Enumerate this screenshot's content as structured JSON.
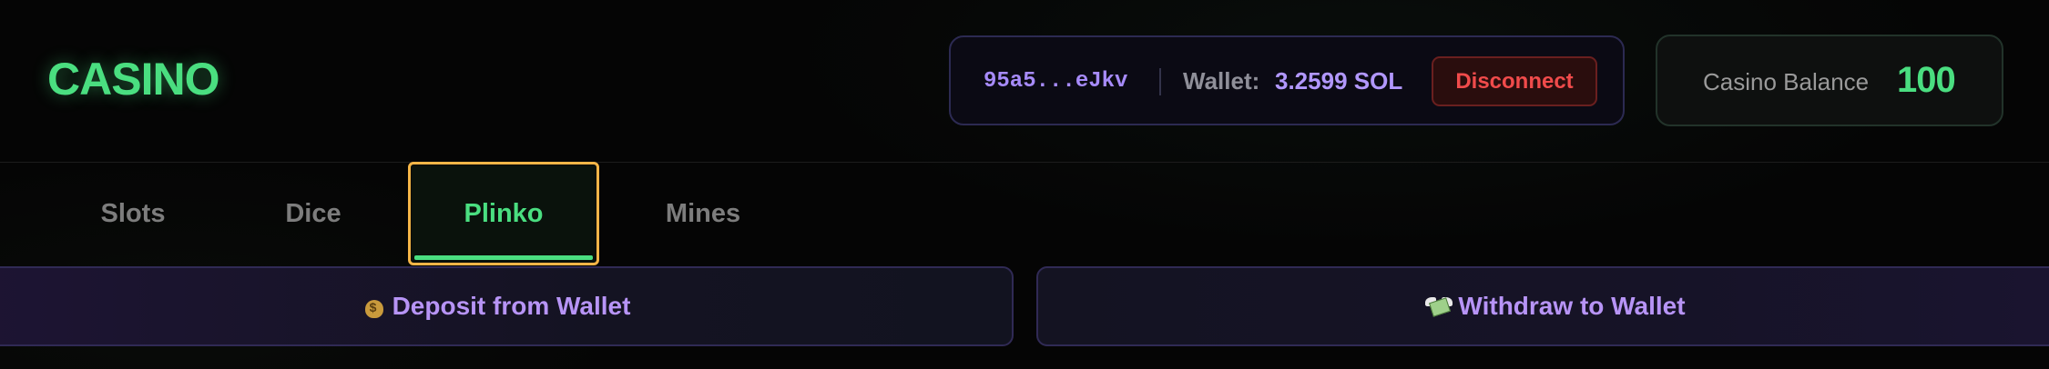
{
  "header": {
    "logo": "CASINO"
  },
  "wallet": {
    "address": "95a5...eJkv",
    "label": "Wallet:",
    "sol_balance": "3.2599 SOL",
    "disconnect_label": "Disconnect"
  },
  "casino_balance": {
    "label": "Casino Balance",
    "value": "100"
  },
  "tabs": [
    {
      "label": "Slots",
      "active": false
    },
    {
      "label": "Dice",
      "active": false
    },
    {
      "label": "Plinko",
      "active": true
    },
    {
      "label": "Mines",
      "active": false
    }
  ],
  "actions": {
    "deposit_label": "Deposit from Wallet",
    "deposit_icon": "money-bag-icon",
    "withdraw_label": "Withdraw to Wallet",
    "withdraw_icon": "money-with-wings-icon"
  },
  "colors": {
    "accent_green": "#4ade80",
    "accent_purple": "#a78bfa",
    "danger_red": "#f04b4b",
    "focus_outline": "#f5b547"
  }
}
